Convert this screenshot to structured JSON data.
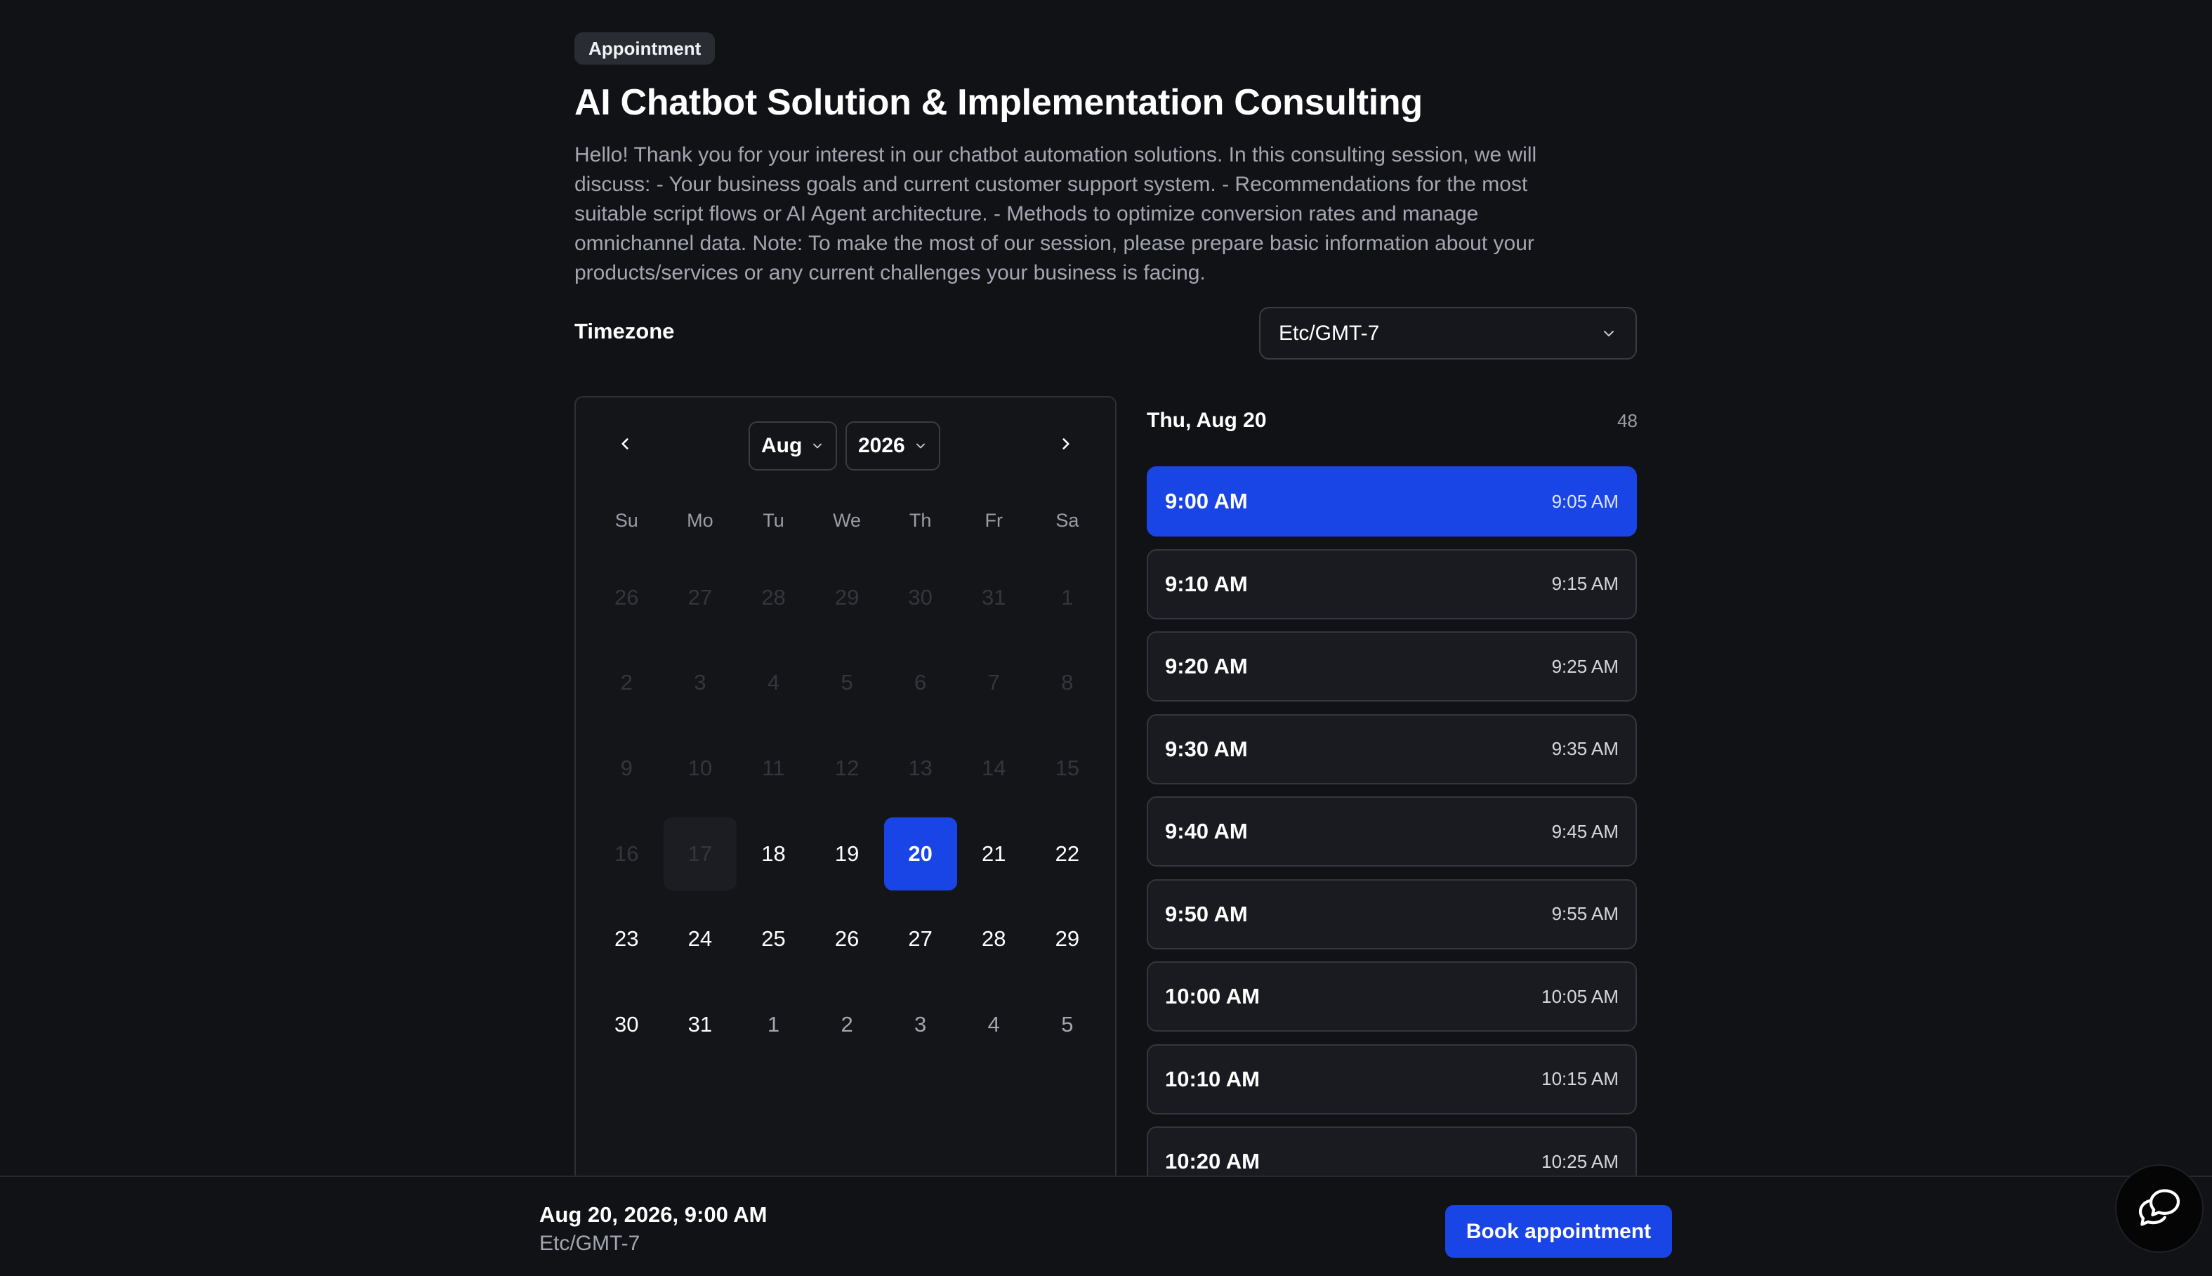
{
  "header": {
    "badge": "Appointment",
    "title": "AI Chatbot Solution & Implementation Consulting",
    "description": "Hello! Thank you for your interest in our chatbot automation solutions. In this consulting session, we will discuss: - Your business goals and current customer support system. - Recommendations for the most suitable script flows or AI Agent architecture. - Methods to optimize conversion rates and manage omnichannel data. Note: To make the most of our session, please prepare basic information about your products/services or any current challenges your business is facing."
  },
  "timezone": {
    "label": "Timezone",
    "value": "Etc/GMT-7"
  },
  "calendar": {
    "month": "Aug",
    "year": "2026",
    "weekdays": [
      "Su",
      "Mo",
      "Tu",
      "We",
      "Th",
      "Fr",
      "Sa"
    ],
    "days": [
      {
        "n": "26",
        "state": "out"
      },
      {
        "n": "27",
        "state": "out"
      },
      {
        "n": "28",
        "state": "out"
      },
      {
        "n": "29",
        "state": "out"
      },
      {
        "n": "30",
        "state": "out"
      },
      {
        "n": "31",
        "state": "out"
      },
      {
        "n": "1",
        "state": "past"
      },
      {
        "n": "2",
        "state": "past"
      },
      {
        "n": "3",
        "state": "past"
      },
      {
        "n": "4",
        "state": "past"
      },
      {
        "n": "5",
        "state": "past"
      },
      {
        "n": "6",
        "state": "past"
      },
      {
        "n": "7",
        "state": "past"
      },
      {
        "n": "8",
        "state": "past"
      },
      {
        "n": "9",
        "state": "past"
      },
      {
        "n": "10",
        "state": "past"
      },
      {
        "n": "11",
        "state": "past"
      },
      {
        "n": "12",
        "state": "past"
      },
      {
        "n": "13",
        "state": "past"
      },
      {
        "n": "14",
        "state": "past"
      },
      {
        "n": "15",
        "state": "past"
      },
      {
        "n": "16",
        "state": "past"
      },
      {
        "n": "17",
        "state": "today"
      },
      {
        "n": "18",
        "state": "avail"
      },
      {
        "n": "19",
        "state": "avail"
      },
      {
        "n": "20",
        "state": "selected"
      },
      {
        "n": "21",
        "state": "avail"
      },
      {
        "n": "22",
        "state": "avail"
      },
      {
        "n": "23",
        "state": "avail"
      },
      {
        "n": "24",
        "state": "avail"
      },
      {
        "n": "25",
        "state": "avail"
      },
      {
        "n": "26",
        "state": "avail"
      },
      {
        "n": "27",
        "state": "avail"
      },
      {
        "n": "28",
        "state": "avail"
      },
      {
        "n": "29",
        "state": "avail"
      },
      {
        "n": "30",
        "state": "avail"
      },
      {
        "n": "31",
        "state": "avail"
      },
      {
        "n": "1",
        "state": "next"
      },
      {
        "n": "2",
        "state": "next"
      },
      {
        "n": "3",
        "state": "next"
      },
      {
        "n": "4",
        "state": "next"
      },
      {
        "n": "5",
        "state": "next"
      }
    ]
  },
  "slots": {
    "date_label": "Thu, Aug 20",
    "count": "48",
    "items": [
      {
        "start": "9:00 AM",
        "end": "9:05 AM",
        "active": true
      },
      {
        "start": "9:10 AM",
        "end": "9:15 AM",
        "active": false
      },
      {
        "start": "9:20 AM",
        "end": "9:25 AM",
        "active": false
      },
      {
        "start": "9:30 AM",
        "end": "9:35 AM",
        "active": false
      },
      {
        "start": "9:40 AM",
        "end": "9:45 AM",
        "active": false
      },
      {
        "start": "9:50 AM",
        "end": "9:55 AM",
        "active": false
      },
      {
        "start": "10:00 AM",
        "end": "10:05 AM",
        "active": false
      },
      {
        "start": "10:10 AM",
        "end": "10:15 AM",
        "active": false
      },
      {
        "start": "10:20 AM",
        "end": "10:25 AM",
        "active": false
      }
    ]
  },
  "footer": {
    "summary_date": "Aug 20, 2026, 9:00 AM",
    "summary_tz": "Etc/GMT-7",
    "book_label": "Book appointment"
  },
  "colors": {
    "accent": "#1a45e6",
    "background": "#111216"
  }
}
